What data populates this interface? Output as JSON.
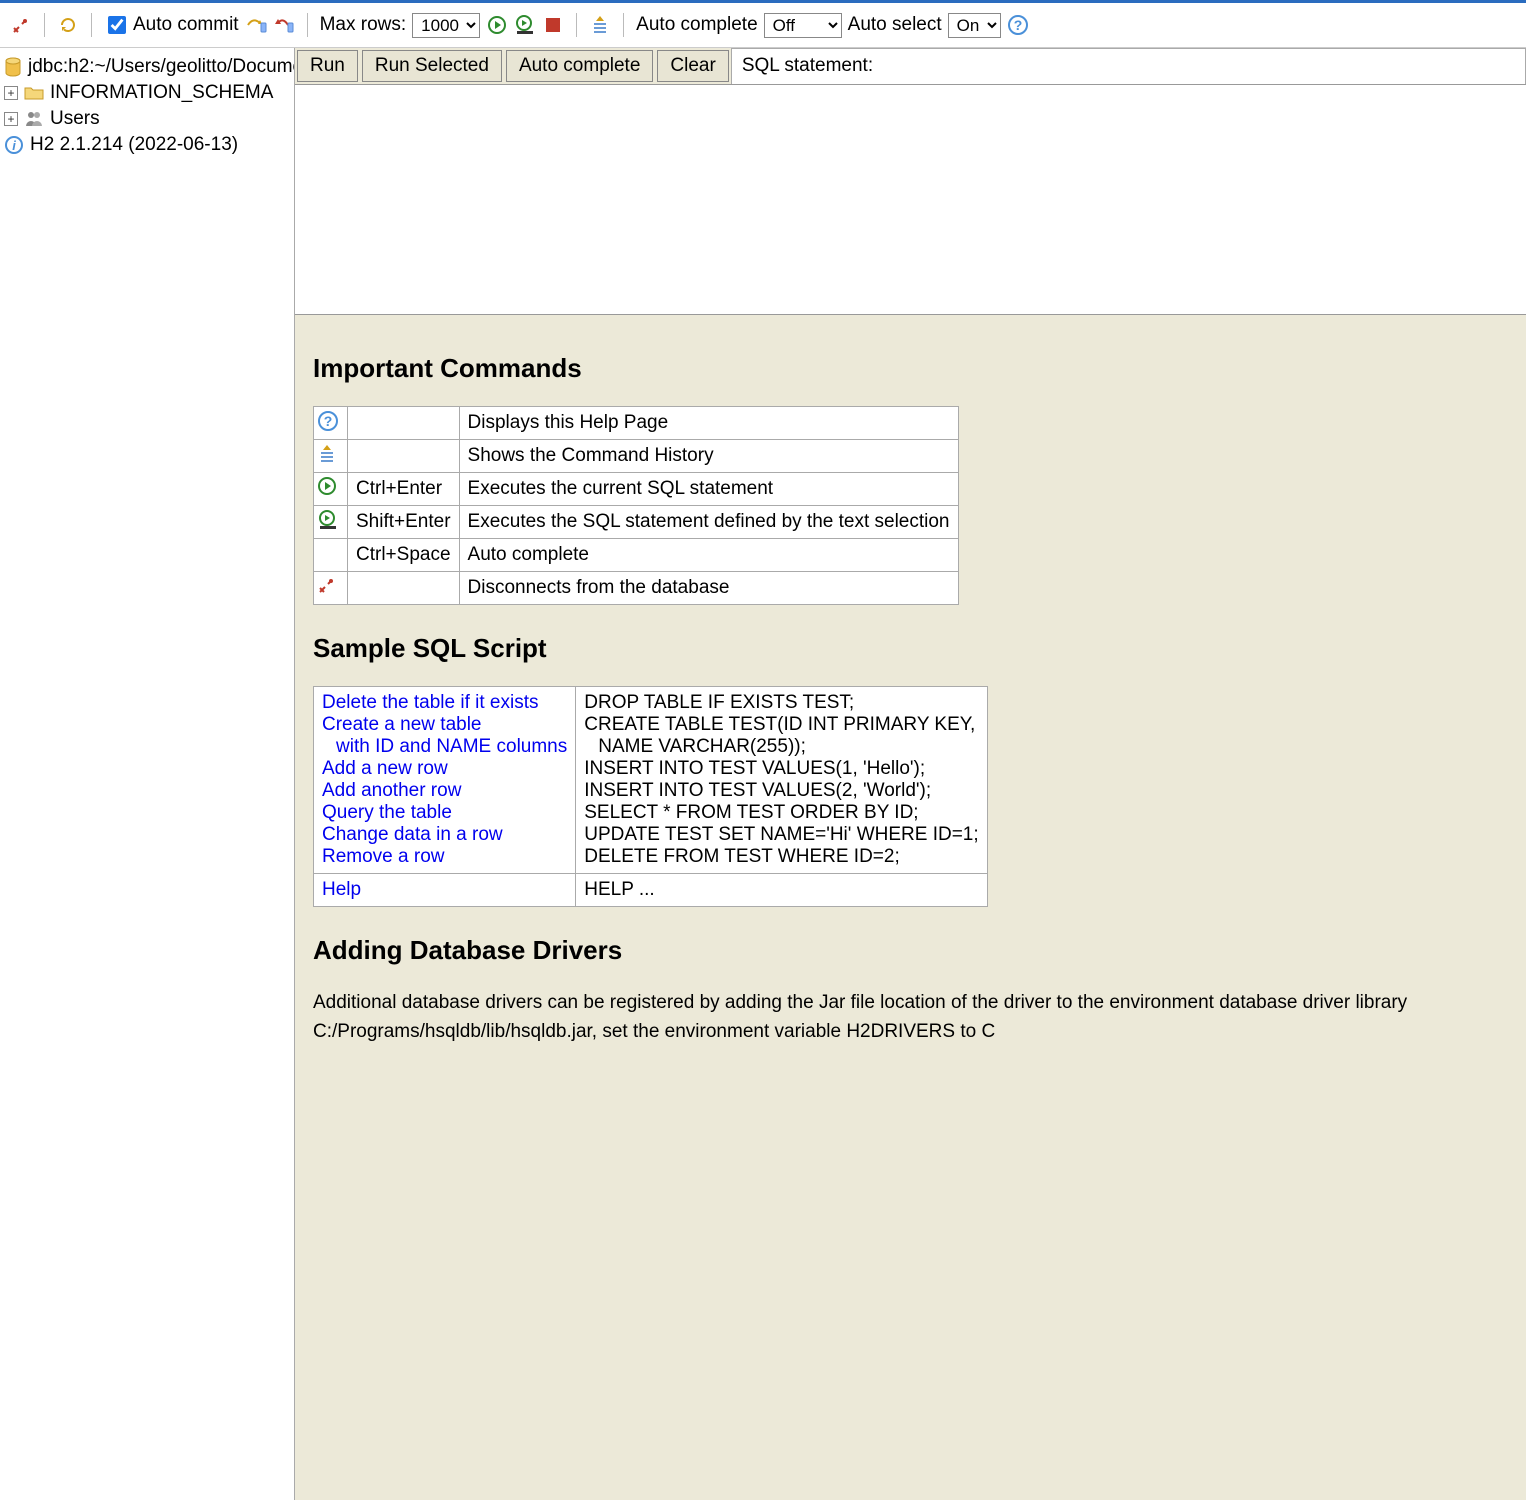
{
  "toolbar": {
    "auto_commit_label": "Auto commit",
    "max_rows_label": "Max rows:",
    "max_rows_value": "1000",
    "auto_complete_label": "Auto complete",
    "auto_complete_value": "Off",
    "auto_select_label": "Auto select",
    "auto_select_value": "On"
  },
  "tree": {
    "db_url": "jdbc:h2:~/Users/geolitto/Docume",
    "schema": "INFORMATION_SCHEMA",
    "users": "Users",
    "version": "H2 2.1.214 (2022-06-13)"
  },
  "querybar": {
    "run": "Run",
    "run_selected": "Run Selected",
    "auto_complete": "Auto complete",
    "clear": "Clear",
    "stmt_label": "SQL statement:"
  },
  "help": {
    "h_commands": "Important Commands",
    "rows": [
      {
        "shortcut": "",
        "desc": "Displays this Help Page"
      },
      {
        "shortcut": "",
        "desc": "Shows the Command History"
      },
      {
        "shortcut": "Ctrl+Enter",
        "desc": "Executes the current SQL statement"
      },
      {
        "shortcut": "Shift+Enter",
        "desc": "Executes the SQL statement defined by the text selection"
      },
      {
        "shortcut": "Ctrl+Space",
        "desc": "Auto complete"
      },
      {
        "shortcut": "",
        "desc": "Disconnects from the database"
      }
    ],
    "h_sample": "Sample SQL Script",
    "samples": [
      {
        "label": "Delete the table if it exists",
        "sql": "DROP TABLE IF EXISTS TEST;"
      },
      {
        "label": "Create a new table",
        "label2": "with ID and NAME columns",
        "sql": "CREATE TABLE TEST(ID INT PRIMARY KEY,",
        "sql2": "NAME VARCHAR(255));"
      },
      {
        "label": "Add a new row",
        "sql": "INSERT INTO TEST VALUES(1, 'Hello');"
      },
      {
        "label": "Add another row",
        "sql": "INSERT INTO TEST VALUES(2, 'World');"
      },
      {
        "label": "Query the table",
        "sql": "SELECT * FROM TEST ORDER BY ID;"
      },
      {
        "label": "Change data in a row",
        "sql": "UPDATE TEST SET NAME='Hi' WHERE ID=1;"
      },
      {
        "label": "Remove a row",
        "sql": "DELETE FROM TEST WHERE ID=2;"
      }
    ],
    "help_label": "Help",
    "help_sql": "HELP ...",
    "h_drivers": "Adding Database Drivers",
    "drivers_text": "Additional database drivers can be registered by adding the Jar file location of the driver to the environment database driver library C:/Programs/hsqldb/lib/hsqldb.jar, set the environment variable H2DRIVERS to C"
  }
}
